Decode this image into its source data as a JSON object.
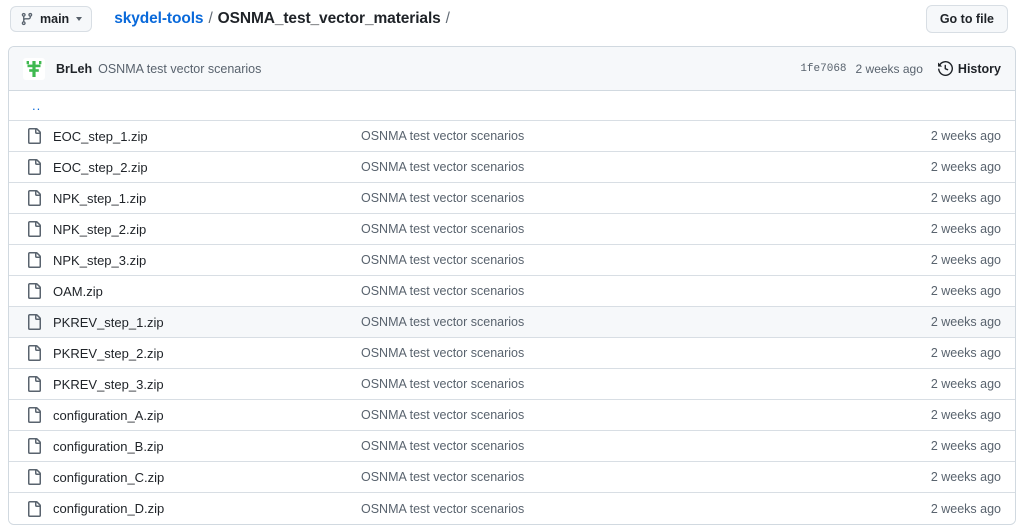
{
  "topbar": {
    "branch": {
      "icon": "git-branch-icon",
      "label": "main",
      "caret": "chevron-down-icon"
    },
    "breadcrumb": {
      "owner": "skydel-tools",
      "separator": "/",
      "current": "OSNMA_test_vector_materials",
      "trailing": "/"
    },
    "go_to_file_label": "Go to file"
  },
  "commit_header": {
    "avatar_name": "user-avatar",
    "author": "BrLeh",
    "message": "OSNMA test vector scenarios",
    "sha": "1fe7068",
    "time": "2 weeks ago",
    "history_label": "History",
    "history_icon": "history-clock-icon"
  },
  "table": {
    "parent_dir_label": "..",
    "file_icon": "file-icon",
    "rows": [
      {
        "name": "EOC_step_1.zip",
        "message": "OSNMA test vector scenarios",
        "time": "2 weeks ago",
        "hovered": false
      },
      {
        "name": "EOC_step_2.zip",
        "message": "OSNMA test vector scenarios",
        "time": "2 weeks ago",
        "hovered": false
      },
      {
        "name": "NPK_step_1.zip",
        "message": "OSNMA test vector scenarios",
        "time": "2 weeks ago",
        "hovered": false
      },
      {
        "name": "NPK_step_2.zip",
        "message": "OSNMA test vector scenarios",
        "time": "2 weeks ago",
        "hovered": false
      },
      {
        "name": "NPK_step_3.zip",
        "message": "OSNMA test vector scenarios",
        "time": "2 weeks ago",
        "hovered": false
      },
      {
        "name": "OAM.zip",
        "message": "OSNMA test vector scenarios",
        "time": "2 weeks ago",
        "hovered": false
      },
      {
        "name": "PKREV_step_1.zip",
        "message": "OSNMA test vector scenarios",
        "time": "2 weeks ago",
        "hovered": true
      },
      {
        "name": "PKREV_step_2.zip",
        "message": "OSNMA test vector scenarios",
        "time": "2 weeks ago",
        "hovered": false
      },
      {
        "name": "PKREV_step_3.zip",
        "message": "OSNMA test vector scenarios",
        "time": "2 weeks ago",
        "hovered": false
      },
      {
        "name": "configuration_A.zip",
        "message": "OSNMA test vector scenarios",
        "time": "2 weeks ago",
        "hovered": false
      },
      {
        "name": "configuration_B.zip",
        "message": "OSNMA test vector scenarios",
        "time": "2 weeks ago",
        "hovered": false
      },
      {
        "name": "configuration_C.zip",
        "message": "OSNMA test vector scenarios",
        "time": "2 weeks ago",
        "hovered": false
      },
      {
        "name": "configuration_D.zip",
        "message": "OSNMA test vector scenarios",
        "time": "2 weeks ago",
        "hovered": false
      }
    ]
  },
  "colors": {
    "link": "#0969da",
    "text": "#1f2328",
    "muted": "#59636e",
    "border": "#d1d9e0",
    "row_border": "#d8dee4",
    "header_bg": "#f6f8fa",
    "avatar_green": "#3fb950"
  }
}
